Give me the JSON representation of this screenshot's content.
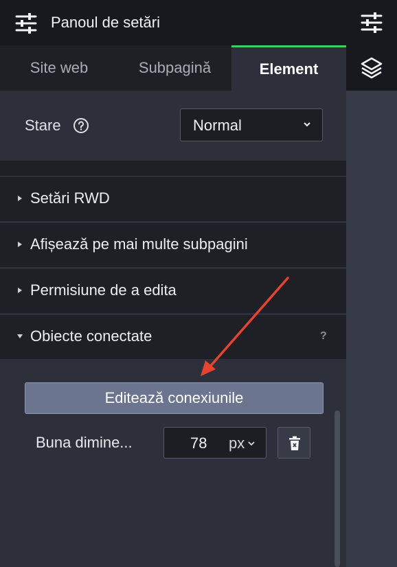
{
  "header": {
    "title": "Panoul de setări",
    "icon": "sliders-icon"
  },
  "tabs": [
    {
      "label": "Site web",
      "active": false
    },
    {
      "label": "Subpagină",
      "active": false
    },
    {
      "label": "Element",
      "active": true
    }
  ],
  "right_rail": {
    "icons": [
      "sliders-icon",
      "layers-icon"
    ]
  },
  "state": {
    "label": "Stare",
    "help_icon": "help-circle-icon",
    "selected": "Normal"
  },
  "sections": [
    {
      "label": "Setări RWD",
      "expanded": false
    },
    {
      "label": "Afișează pe mai multe subpagini",
      "expanded": false
    },
    {
      "label": "Permisiune de a edita",
      "expanded": false
    },
    {
      "label": "Obiecte conectate",
      "expanded": true,
      "help": "?"
    }
  ],
  "connected_objects": {
    "edit_button": "Editează conexiunile",
    "items": [
      {
        "label": "Buna dimine...",
        "value": "78",
        "unit": "px",
        "delete_icon": "trash-icon"
      }
    ]
  },
  "annotation": {
    "arrow_color": "#e8432d"
  },
  "colors": {
    "active_tab_accent": "#3ecf6a",
    "button_bg": "#6c7590"
  }
}
